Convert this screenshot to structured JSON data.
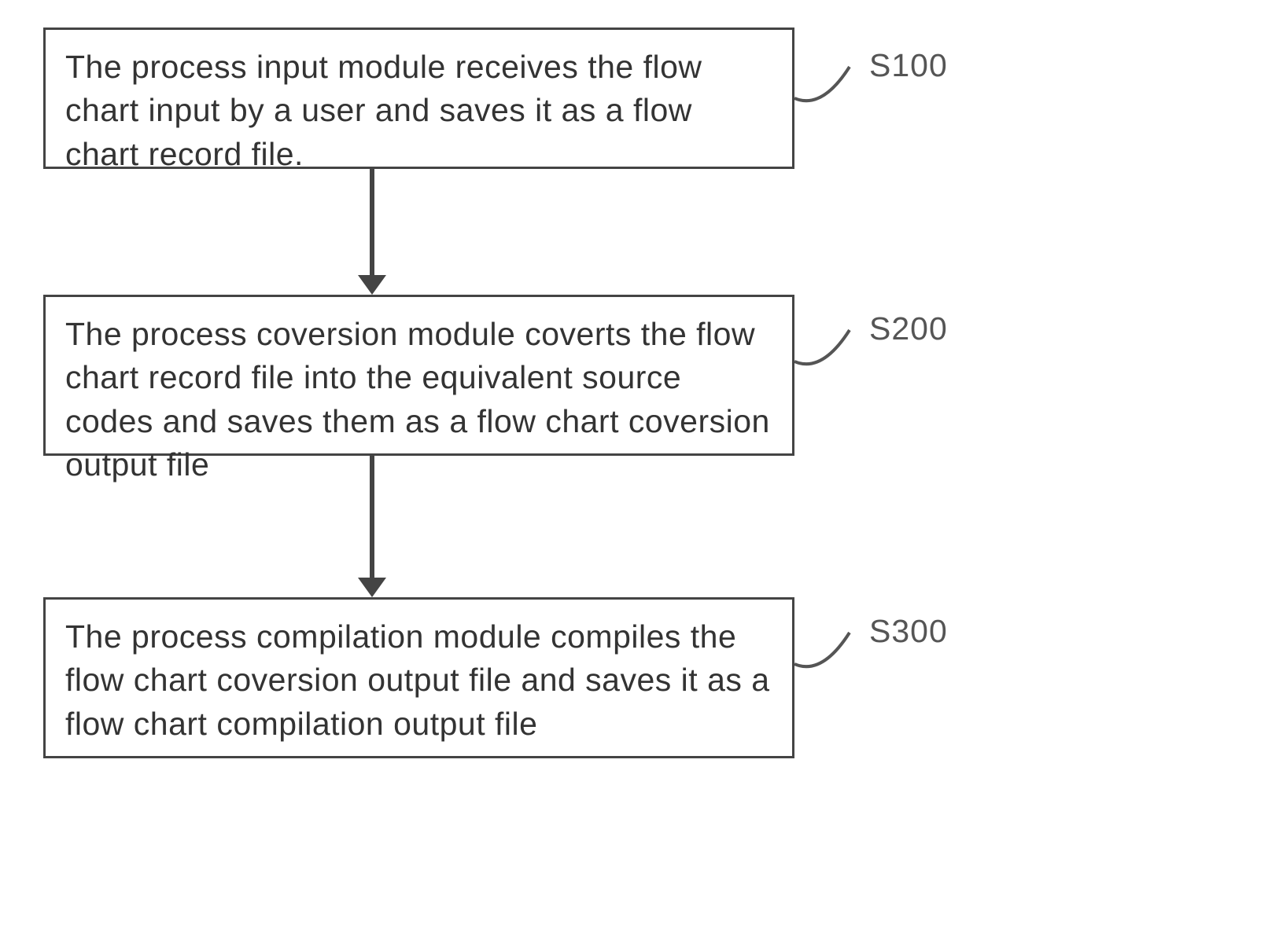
{
  "flowchart": {
    "steps": [
      {
        "id": "S100",
        "label": "S100",
        "text": "The process input module receives the flow chart input by a user and saves it as a flow chart record file."
      },
      {
        "id": "S200",
        "label": "S200",
        "text": "The process coversion module coverts the flow chart record file into the equivalent source codes and saves them as a flow chart coversion output file"
      },
      {
        "id": "S300",
        "label": "S300",
        "text": "The process compilation module compiles the flow chart coversion output file and saves it as a flow chart compilation output file"
      }
    ],
    "flow": [
      {
        "from": "S100",
        "to": "S200"
      },
      {
        "from": "S200",
        "to": "S300"
      }
    ]
  }
}
